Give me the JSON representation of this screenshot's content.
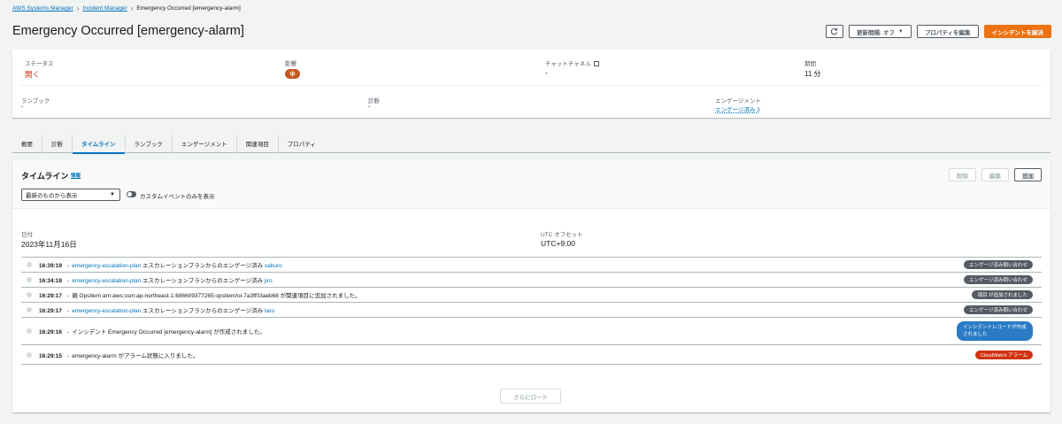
{
  "breadcrumb": {
    "items": [
      "AWS Systems Manager",
      "Incident Manager"
    ],
    "current": "Emergency Occurred [emergency-alarm]"
  },
  "page": {
    "title": "Emergency Occurred [emergency-alarm]"
  },
  "header_actions": {
    "refresh_icon": "refresh-icon",
    "refresh_interval": "更新間隔: オフ",
    "edit_properties": "プロパティを編集",
    "resolve": "インシデントを解決"
  },
  "summary": {
    "status_label": "ステータス",
    "status_value": "開く",
    "impact_label": "影響",
    "impact_value": "中",
    "chat_label": "チャットチャネル",
    "chat_value": "-",
    "duration_label": "期間",
    "duration_value": "11 分",
    "runbook_label": "ランブック",
    "runbook_value": "-",
    "diagnosis_label": "診断",
    "diagnosis_value": "-",
    "engagement_label": "エンゲージメント",
    "engagement_value": "エンゲージ済み 3"
  },
  "tabs": [
    "概要",
    "診断",
    "タイムライン",
    "ランブック",
    "エンゲージメント",
    "関連項目",
    "プロパティ"
  ],
  "timeline": {
    "title": "タイムライン",
    "info": "情報",
    "delete": "削除",
    "edit": "編集",
    "add": "追加",
    "sort_value": "最新のものから表示",
    "toggle_label": "カスタムイベントのみを表示",
    "date_label": "日付",
    "date_value": "2023年11月16日",
    "offset_label": "UTC オフセット",
    "offset_value": "UTC+9:00",
    "events": [
      {
        "time": "16:39:19",
        "sep": "-",
        "link": "emergency-escalation-plan",
        "text": " エスカレーションプランからのエンゲージ済み ",
        "target": "saburo",
        "badge": "エンゲージ済み問い合わせ",
        "badge_color": "#545b64"
      },
      {
        "time": "16:34:18",
        "sep": "-",
        "link": "emergency-escalation-plan",
        "text": " エスカレーションプランからのエンゲージ済み ",
        "target": "jiro",
        "badge": "エンゲージ済み問い合わせ",
        "badge_color": "#545b64"
      },
      {
        "time": "16:29:17",
        "sep": "-",
        "link": "",
        "text": "親 OpsItem arn:aws:ssm:ap-northeast-1:686609377265:opsitem/oi-7a3ff03aeb68 が関連項目に追加されました。",
        "target": "",
        "badge": "項目 が追加されました",
        "badge_color": "#545b64"
      },
      {
        "time": "16:29:17",
        "sep": "-",
        "link": "emergency-escalation-plan",
        "text": " エスカレーションプランからのエンゲージ済み ",
        "target": "taro",
        "badge": "エンゲージ済み問い合わせ",
        "badge_color": "#545b64"
      },
      {
        "time": "16:29:16",
        "sep": "-",
        "link": "",
        "text": "インシデント Emergency Occurred [emergency-alarm] が作成されました。",
        "target": "",
        "badge": "インシデントレコードが作成されました",
        "badge_color": "#2b7bc4"
      },
      {
        "time": "16:29:15",
        "sep": "-",
        "link": "",
        "text": "emergency-alarm がアラーム状態に入りました。",
        "target": "",
        "badge": "CloudWatch アラーム",
        "badge_color": "#d13212"
      }
    ],
    "load_more": "さらにロード"
  }
}
